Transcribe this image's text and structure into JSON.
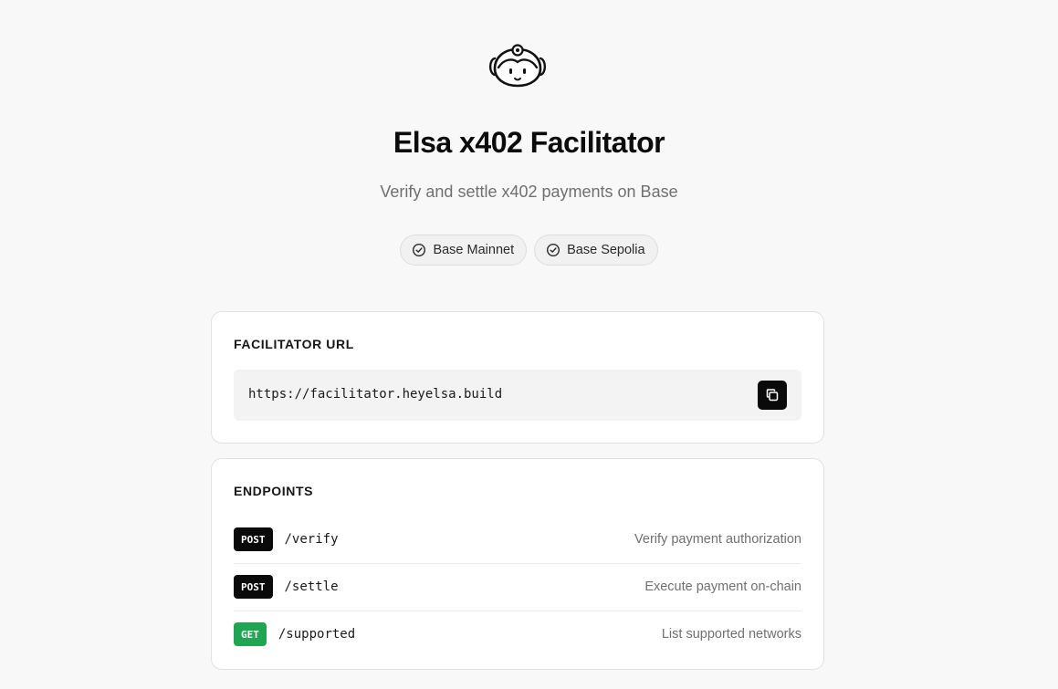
{
  "header": {
    "title": "Elsa x402 Facilitator",
    "subtitle": "Verify and settle x402 payments on Base",
    "logo_icon": "robot-mascot-icon"
  },
  "networks": [
    {
      "label": "Base Mainnet",
      "icon": "check-circle-icon"
    },
    {
      "label": "Base Sepolia",
      "icon": "check-circle-icon"
    }
  ],
  "facilitator": {
    "heading": "FACILITATOR URL",
    "url": "https://facilitator.heyelsa.build",
    "copy_icon": "copy-icon"
  },
  "endpoints": {
    "heading": "ENDPOINTS",
    "items": [
      {
        "method": "POST",
        "path": "/verify",
        "description": "Verify payment authorization"
      },
      {
        "method": "POST",
        "path": "/settle",
        "description": "Execute payment on-chain"
      },
      {
        "method": "GET",
        "path": "/supported",
        "description": "List supported networks"
      }
    ]
  },
  "colors": {
    "background": "#f8f8f8",
    "post_badge": "#0a0a0a",
    "get_badge": "#22a553"
  }
}
